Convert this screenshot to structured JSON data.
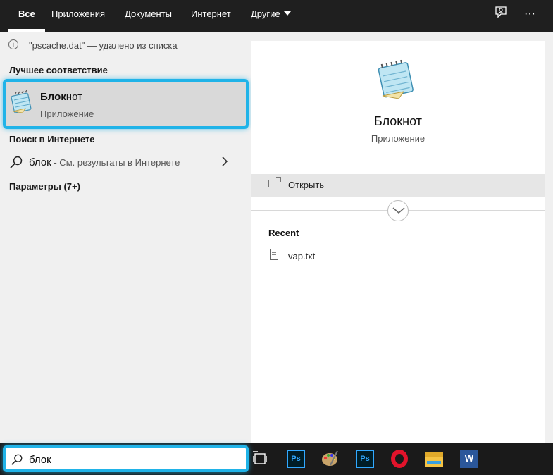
{
  "tabs": {
    "all": "Все",
    "apps": "Приложения",
    "docs": "Документы",
    "web": "Интернет",
    "other": "Другие"
  },
  "icons": {
    "feedback": "feedback-icon",
    "more": "···"
  },
  "notice": "\"pscache.dat\" — удалено из списка",
  "best_match": {
    "heading": "Лучшее соответствие",
    "title_bold": "Блок",
    "title_rest": "нот",
    "subtitle": "Приложение"
  },
  "web_search": {
    "heading": "Поиск в Интернете",
    "query": "блок",
    "hint": " - См. результаты в Интернете"
  },
  "settings_heading": "Параметры (7+)",
  "detail": {
    "title": "Блокнот",
    "subtitle": "Приложение",
    "open_label": "Открыть",
    "recent_heading": "Recent",
    "recent_items": [
      "vap.txt"
    ]
  },
  "search": {
    "value": "блок"
  },
  "taskbar": {
    "ps_label": "Ps",
    "word_label": "W"
  },
  "colors": {
    "accent": "#20b3e8",
    "topbar": "#1f1f1f"
  }
}
